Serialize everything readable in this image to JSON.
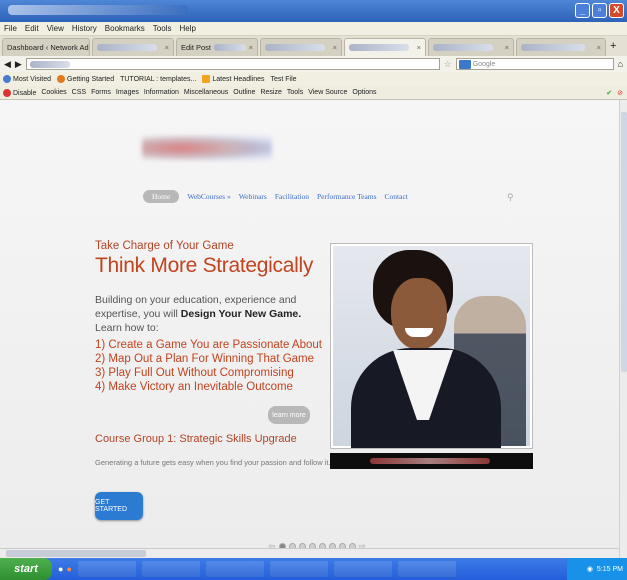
{
  "browser": {
    "menu": [
      "File",
      "Edit",
      "View",
      "History",
      "Bookmarks",
      "Tools",
      "Help"
    ],
    "tabs": [
      {
        "label": "Dashboard ‹ Network Admin ..."
      },
      {
        "label": ""
      },
      {
        "label": "Edit Post"
      },
      {
        "label": ""
      },
      {
        "label": "",
        "active": true
      },
      {
        "label": ""
      },
      {
        "label": ""
      }
    ],
    "search_placeholder": "Google",
    "bookmarks": [
      "Most Visited",
      "Getting Started",
      "TUTORIAL : templates...",
      "Latest Headlines",
      "Test File"
    ],
    "devbar": [
      "Disable",
      "Cookies",
      "CSS",
      "Forms",
      "Images",
      "Information",
      "Miscellaneous",
      "Outline",
      "Resize",
      "Tools",
      "View Source",
      "Options"
    ]
  },
  "site": {
    "nav": [
      "Home",
      "WebCourses",
      "Webinars",
      "Facilitation",
      "Performance Teams",
      "Contact"
    ],
    "eyebrow": "Take Charge of Your Game",
    "headline": "Think More Strategically",
    "intro_1": "Building on your education, experience and expertise, you will ",
    "intro_bold": "Design Your New Game.",
    "intro_2": " Learn how to:",
    "steps": [
      "1) Create a Game You are Passionate About",
      "2) Map Out a Plan For Winning That Game",
      "3) Play Full Out Without Compromising",
      "4) Make Victory an Inevitable Outcome"
    ],
    "learn_more": "learn more",
    "course_title": "Course Group 1: Strategic Skills Upgrade",
    "course_sub": "Generating a future gets easy when you find your passion and follow it.",
    "cta": "GET STARTED"
  },
  "taskbar": {
    "start": "start",
    "clock": "5:15 PM"
  },
  "colors": {
    "accent": "#c2431f",
    "link": "#3b6ec7",
    "cta": "#2a7bd1"
  }
}
